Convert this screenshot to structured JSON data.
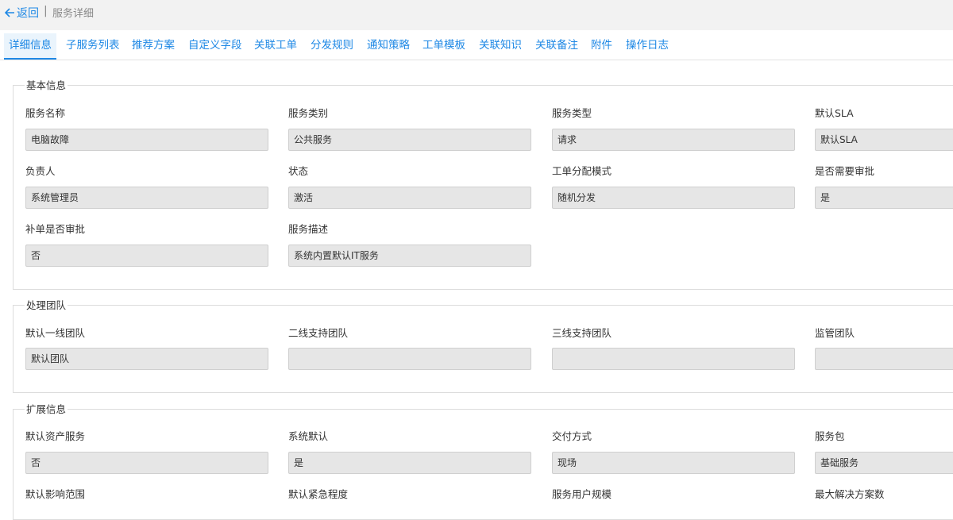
{
  "header": {
    "back_label": "返回",
    "separator": "|",
    "title": "服务详细"
  },
  "tabs": [
    {
      "label": "详细信息",
      "active": true
    },
    {
      "label": "子服务列表"
    },
    {
      "label": "推荐方案"
    },
    {
      "label": "自定义字段"
    },
    {
      "label": "关联工单"
    },
    {
      "label": "分发规则"
    },
    {
      "label": "通知策略"
    },
    {
      "label": "工单模板"
    },
    {
      "label": "关联知识"
    },
    {
      "label": "关联备注"
    },
    {
      "label": "附件"
    },
    {
      "label": "操作日志"
    }
  ],
  "basic": {
    "legend": "基本信息",
    "fields": [
      {
        "label": "服务名称",
        "value": "电脑故障"
      },
      {
        "label": "服务类别",
        "value": "公共服务"
      },
      {
        "label": "服务类型",
        "value": "请求"
      },
      {
        "label": "默认SLA",
        "value": "默认SLA"
      },
      {
        "label": "负责人",
        "value": "系统管理员"
      },
      {
        "label": "状态",
        "value": "激活"
      },
      {
        "label": "工单分配模式",
        "value": "随机分发"
      },
      {
        "label": "是否需要审批",
        "value": "是"
      },
      {
        "label": "补单是否审批",
        "value": "否"
      },
      {
        "label": "服务描述",
        "value": "系统内置默认IT服务"
      }
    ]
  },
  "team": {
    "legend": "处理团队",
    "fields": [
      {
        "label": "默认一线团队",
        "value": "默认团队"
      },
      {
        "label": "二线支持团队",
        "value": ""
      },
      {
        "label": "三线支持团队",
        "value": ""
      },
      {
        "label": "监管团队",
        "value": ""
      }
    ]
  },
  "ext": {
    "legend": "扩展信息",
    "fields": [
      {
        "label": "默认资产服务",
        "value": "否"
      },
      {
        "label": "系统默认",
        "value": "是"
      },
      {
        "label": "交付方式",
        "value": "现场"
      },
      {
        "label": "服务包",
        "value": "基础服务"
      },
      {
        "label": "默认影响范围",
        "value": ""
      },
      {
        "label": "默认紧急程度",
        "value": ""
      },
      {
        "label": "服务用户规模",
        "value": ""
      },
      {
        "label": "最大解决方案数",
        "value": ""
      }
    ]
  }
}
